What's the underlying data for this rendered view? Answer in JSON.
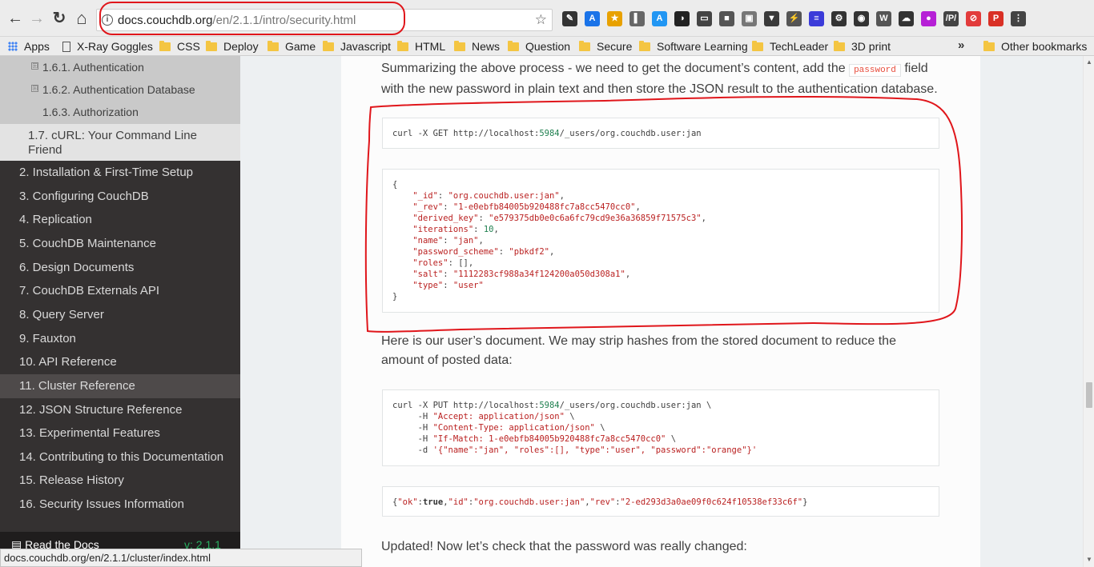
{
  "browser": {
    "url_host": "docs.couchdb.org",
    "url_path": "/en/2.1.1/intro/security.html",
    "back_glyph": "←",
    "forward_glyph": "→",
    "reload_glyph": "↻",
    "home_glyph": "⌂",
    "star_glyph": "☆",
    "info_glyph": "i",
    "extensions": [
      {
        "icon": "pen-icon",
        "color": "#333333",
        "glyph": "✎"
      },
      {
        "icon": "text-a-icon",
        "color": "#1a73e8",
        "glyph": "A"
      },
      {
        "icon": "star-icon",
        "color": "#e8a100",
        "glyph": "★"
      },
      {
        "icon": "clip-icon",
        "color": "#666666",
        "glyph": "▌"
      },
      {
        "icon": "a-box-icon",
        "color": "#2196f3",
        "glyph": "A"
      },
      {
        "icon": "contrast-icon",
        "color": "#222222",
        "glyph": "◑"
      },
      {
        "icon": "window-icon",
        "color": "#444444",
        "glyph": "▭"
      },
      {
        "icon": "anvil-icon",
        "color": "#555555",
        "glyph": "■"
      },
      {
        "icon": "image-icon",
        "color": "#777777",
        "glyph": "▣"
      },
      {
        "icon": "vue-icon",
        "color": "#3a3a3a",
        "glyph": "▼"
      },
      {
        "icon": "bolt-icon",
        "color": "#555555",
        "glyph": "⚡"
      },
      {
        "icon": "bars-icon",
        "color": "#3b3bd9",
        "glyph": "≡"
      },
      {
        "icon": "gear-icon",
        "color": "#333333",
        "glyph": "⚙"
      },
      {
        "icon": "camera-icon",
        "color": "#333333",
        "glyph": "◉"
      },
      {
        "icon": "w-icon",
        "color": "#555555",
        "glyph": "W"
      },
      {
        "icon": "cloud-icon",
        "color": "#333333",
        "glyph": "☁"
      },
      {
        "icon": "circle-purple-icon",
        "color": "#b620d6",
        "glyph": "●"
      },
      {
        "icon": "regex-icon",
        "color": "#444444",
        "glyph": "/P/"
      },
      {
        "icon": "block-icon",
        "color": "#e23b3b",
        "glyph": "⊘"
      },
      {
        "icon": "pdf-icon",
        "color": "#d93025",
        "glyph": "P"
      },
      {
        "icon": "menu-icon",
        "color": "#444444",
        "glyph": "⋮"
      }
    ]
  },
  "bookmarks": {
    "apps": "Apps",
    "items": [
      "X-Ray Goggles",
      "CSS",
      "Deploy",
      "Game",
      "Javascript",
      "HTML",
      "News",
      "Question",
      "Secure",
      "Software Learning",
      "TechLeader",
      "3D print"
    ],
    "overflow": "»",
    "other": "Other bookmarks"
  },
  "sidebar": {
    "subitems": [
      {
        "expander": "⊞",
        "label": "1.6.1. Authentication"
      },
      {
        "expander": "⊞",
        "label": "1.6.2. Authentication Database"
      },
      {
        "expander": "",
        "label": "1.6.3. Authorization"
      }
    ],
    "current": "1.7. cURL: Your Command Line Friend",
    "items": [
      "2. Installation & First-Time Setup",
      "3. Configuring CouchDB",
      "4. Replication",
      "5. CouchDB Maintenance",
      "6. Design Documents",
      "7. CouchDB Externals API",
      "8. Query Server",
      "9. Fauxton",
      "10. API Reference",
      "11. Cluster Reference",
      "12. JSON Structure Reference",
      "13. Experimental Features",
      "14. Contributing to this Documentation",
      "15. Release History",
      "16. Security Issues Information"
    ],
    "hover_index": 9,
    "footer": {
      "label": "Read the Docs",
      "version": "v: 2.1.1"
    }
  },
  "content": {
    "para1_a": "Summarizing the above process - we need to get the document’s content, add the",
    "para1_code": "password",
    "para1_b": "field with the new password in plain text and then store the JSON result to the authentication database.",
    "code1": {
      "a": "curl -X GET http://localhost:",
      "port": "5984",
      "b": "/_users/org.couchdb.user:jan"
    },
    "code2": [
      [
        [
          "p",
          "{"
        ]
      ],
      [
        [
          "p",
          "    "
        ],
        [
          "s",
          "\"_id\""
        ],
        [
          "p",
          ": "
        ],
        [
          "s",
          "\"org.couchdb.user:jan\""
        ],
        [
          "p",
          ","
        ]
      ],
      [
        [
          "p",
          "    "
        ],
        [
          "s",
          "\"_rev\""
        ],
        [
          "p",
          ": "
        ],
        [
          "s",
          "\"1-e0ebfb84005b920488fc7a8cc5470cc0\""
        ],
        [
          "p",
          ","
        ]
      ],
      [
        [
          "p",
          "    "
        ],
        [
          "s",
          "\"derived_key\""
        ],
        [
          "p",
          ": "
        ],
        [
          "s",
          "\"e579375db0e0c6a6fc79cd9e36a36859f71575c3\""
        ],
        [
          "p",
          ","
        ]
      ],
      [
        [
          "p",
          "    "
        ],
        [
          "s",
          "\"iterations\""
        ],
        [
          "p",
          ": "
        ],
        [
          "n",
          "10"
        ],
        [
          "p",
          ","
        ]
      ],
      [
        [
          "p",
          "    "
        ],
        [
          "s",
          "\"name\""
        ],
        [
          "p",
          ": "
        ],
        [
          "s",
          "\"jan\""
        ],
        [
          "p",
          ","
        ]
      ],
      [
        [
          "p",
          "    "
        ],
        [
          "s",
          "\"password_scheme\""
        ],
        [
          "p",
          ": "
        ],
        [
          "s",
          "\"pbkdf2\""
        ],
        [
          "p",
          ","
        ]
      ],
      [
        [
          "p",
          "    "
        ],
        [
          "s",
          "\"roles\""
        ],
        [
          "p",
          ": [],"
        ]
      ],
      [
        [
          "p",
          "    "
        ],
        [
          "s",
          "\"salt\""
        ],
        [
          "p",
          ": "
        ],
        [
          "s",
          "\"1112283cf988a34f124200a050d308a1\""
        ],
        [
          "p",
          ","
        ]
      ],
      [
        [
          "p",
          "    "
        ],
        [
          "s",
          "\"type\""
        ],
        [
          "p",
          ": "
        ],
        [
          "s",
          "\"user\""
        ]
      ],
      [
        [
          "p",
          "}"
        ]
      ]
    ],
    "para2": "Here is our user’s document. We may strip hashes from the stored document to reduce the amount of posted data:",
    "code3": [
      [
        [
          "p",
          "curl -X PUT http://localhost:"
        ],
        [
          "n",
          "5984"
        ],
        [
          "p",
          "/_users/org.couchdb.user:jan \\"
        ]
      ],
      [
        [
          "p",
          "     -H "
        ],
        [
          "s",
          "\"Accept: application/json\""
        ],
        [
          "p",
          " \\"
        ]
      ],
      [
        [
          "p",
          "     -H "
        ],
        [
          "s",
          "\"Content-Type: application/json\""
        ],
        [
          "p",
          " \\"
        ]
      ],
      [
        [
          "p",
          "     -H "
        ],
        [
          "s",
          "\"If-Match: 1-e0ebfb84005b920488fc7a8cc5470cc0\""
        ],
        [
          "p",
          " \\"
        ]
      ],
      [
        [
          "p",
          "     -d "
        ],
        [
          "s",
          "'{\"name\":\"jan\", \"roles\":[], \"type\":\"user\", \"password\":\"orange\"}'"
        ]
      ]
    ],
    "code4": [
      [
        [
          "p",
          "{"
        ],
        [
          "s",
          "\"ok\""
        ],
        [
          "p",
          ":"
        ],
        [
          "b",
          "true"
        ],
        [
          "p",
          ","
        ],
        [
          "s",
          "\"id\""
        ],
        [
          "p",
          ":"
        ],
        [
          "s",
          "\"org.couchdb.user:jan\""
        ],
        [
          "p",
          ","
        ],
        [
          "s",
          "\"rev\""
        ],
        [
          "p",
          ":"
        ],
        [
          "s",
          "\"2-ed293d3a0ae09f0c624f10538ef33c6f\""
        ],
        [
          "p",
          "}"
        ]
      ]
    ],
    "para3": "Updated! Now let’s check that the password was really changed:"
  },
  "status_url": "docs.couchdb.org/en/2.1.1/cluster/index.html",
  "colors": {
    "annotation": "#e0161b",
    "sidebar_bg": "#343131",
    "string": "#ba2121",
    "number": "#208050"
  }
}
